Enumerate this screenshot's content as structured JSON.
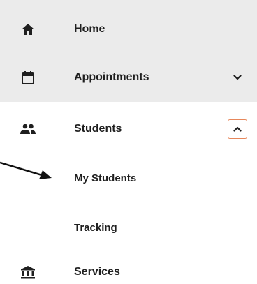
{
  "nav": {
    "home": {
      "label": "Home",
      "icon": "home-icon"
    },
    "appointments": {
      "label": "Appointments",
      "icon": "calendar-icon",
      "expanded": false
    },
    "students": {
      "label": "Students",
      "icon": "people-icon",
      "expanded": true,
      "children": [
        {
          "label": "My Students"
        },
        {
          "label": "Tracking"
        }
      ]
    },
    "services": {
      "label": "Services",
      "icon": "bank-icon"
    }
  },
  "colors": {
    "selected_bg": "#ebebeb",
    "text": "#1f1f1f",
    "expand_button_border": "#e7875b"
  }
}
